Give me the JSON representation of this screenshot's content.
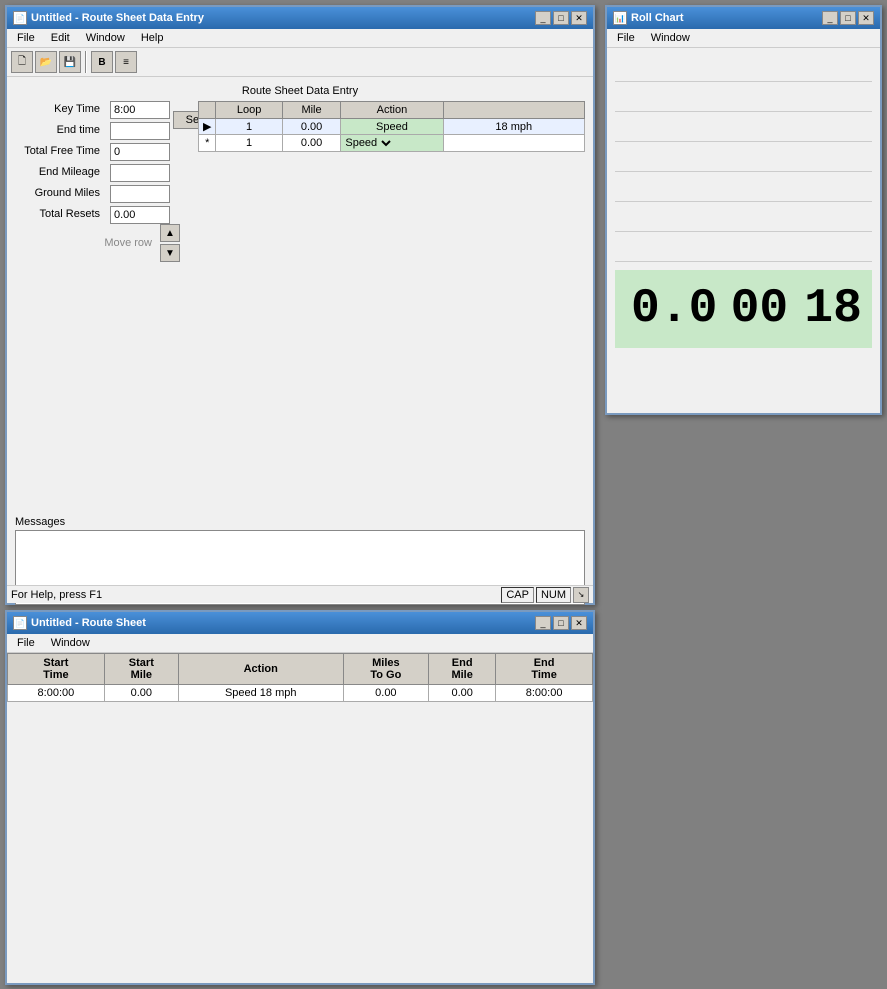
{
  "windows": {
    "main": {
      "title": "Untitled - Route Sheet Data Entry",
      "icon": "📄",
      "menu": [
        "File",
        "Edit",
        "Window",
        "Help"
      ],
      "toolbar": {
        "buttons": [
          "new",
          "open",
          "save",
          "sep",
          "bold",
          "italic"
        ]
      },
      "section_title": "Route Sheet Data Entry",
      "form": {
        "key_time_label": "Key Time",
        "key_time_value": "8:00",
        "end_time_label": "End time",
        "end_time_value": "",
        "total_free_time_label": "Total Free Time",
        "total_free_time_value": "0",
        "end_mileage_label": "End Mileage",
        "end_mileage_value": "",
        "ground_miles_label": "Ground Miles",
        "ground_miles_value": "",
        "total_resets_label": "Total Resets",
        "total_resets_value": "0.00",
        "setup_btn": "Setup"
      },
      "table": {
        "headers": [
          "",
          "Loop",
          "Mile",
          "Action",
          ""
        ],
        "rows": [
          {
            "arrow": "▶",
            "loop": "1",
            "mile": "0.00",
            "action": "Speed",
            "detail": "18 mph",
            "selected": true
          },
          {
            "arrow": "*",
            "loop": "1",
            "mile": "0.00",
            "action": "Speed",
            "detail": "",
            "selected": false,
            "dropdown": true
          }
        ]
      },
      "move_row_label": "Move row",
      "messages_label": "Messages",
      "status": {
        "help_text": "For Help, press F1",
        "cap": "CAP",
        "num": "NUM"
      }
    },
    "roll": {
      "title": "Roll Chart",
      "menu": [
        "File",
        "Window"
      ],
      "display": {
        "value1": "0.0",
        "value2": "00",
        "value3": "18"
      }
    },
    "route": {
      "title": "Untitled - Route Sheet",
      "menu": [
        "File",
        "Window"
      ],
      "table": {
        "headers": [
          "Start\nTime",
          "Start\nMile",
          "Action",
          "Miles\nTo Go",
          "End\nMile",
          "End\nTime"
        ],
        "col1": "Start Time",
        "col2": "Start Mile",
        "col3": "Action",
        "col4": "Miles To Go",
        "col5": "End Mile",
        "col6": "End Time",
        "rows": [
          {
            "start_time": "8:00:00",
            "start_mile": "0.00",
            "action": "Speed 18 mph",
            "miles_to_go": "0.00",
            "end_mile": "0.00",
            "end_time": "8:00:00"
          }
        ]
      }
    }
  }
}
